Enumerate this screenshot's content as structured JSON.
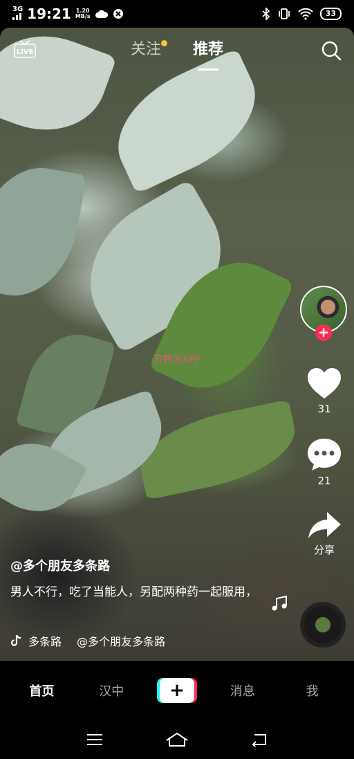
{
  "status_bar": {
    "network": "3G",
    "time": "19:21",
    "speed_value": "1.20",
    "speed_unit": "MB/s",
    "battery": "33"
  },
  "top_tabs": {
    "live_label": "LIVE",
    "following": "关注",
    "recommended": "推荐"
  },
  "watermark": "万物志APP",
  "rail": {
    "likes": "31",
    "comments": "21",
    "share": "分享"
  },
  "post": {
    "author": "@多个朋友多条路",
    "caption": "男人不行，吃了当能人，另配两种药一起服用，",
    "music_title": "多条路",
    "music_author": "@多个朋友多条路"
  },
  "bottom_nav": {
    "home": "首页",
    "city": "汉中",
    "create": "+",
    "messages": "消息",
    "me": "我"
  },
  "colors": {
    "accent_red": "#fe2c55",
    "accent_cyan": "#25f4ee",
    "notification_dot": "#f7c43c"
  }
}
